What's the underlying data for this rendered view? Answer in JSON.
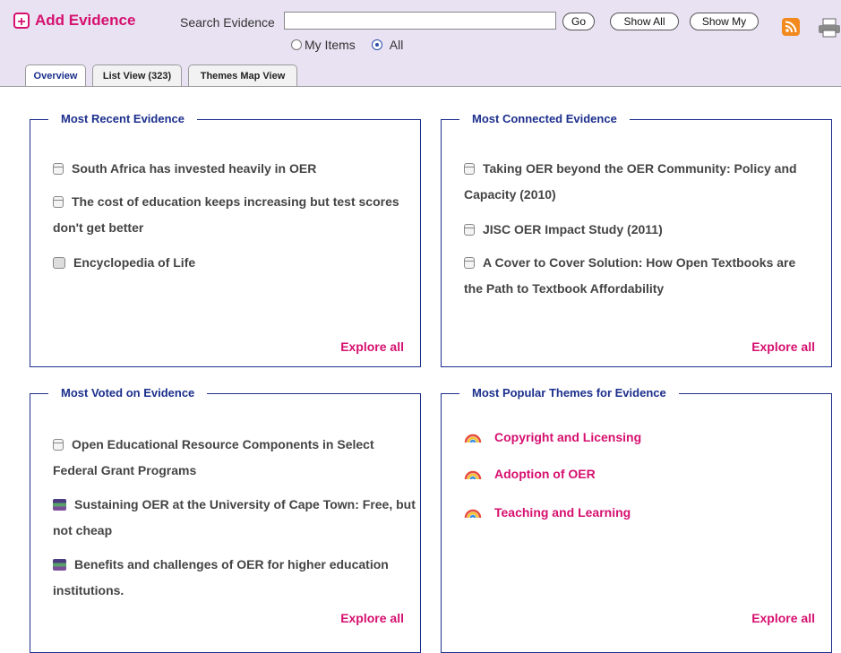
{
  "header": {
    "add_label": "Add Evidence",
    "search_label": "Search Evidence",
    "search_value": "",
    "go_label": "Go",
    "show_all_label": "Show All",
    "show_my_label": "Show My",
    "radio_my_items": "My Items",
    "radio_all": "All",
    "selected_radio": "All"
  },
  "tabs": [
    {
      "label": "Overview",
      "active": true
    },
    {
      "label": "List View (323)",
      "active": false
    },
    {
      "label": "Themes Map View",
      "active": false
    }
  ],
  "panels": {
    "recent": {
      "title": "Most Recent Evidence",
      "items": [
        {
          "icon": "document-icon",
          "text": "South Africa has invested heavily in OER"
        },
        {
          "icon": "document-icon",
          "text": "The cost of education keeps increasing but test scores don't get better"
        },
        {
          "icon": "website-icon",
          "text": "Encyclopedia of Life"
        }
      ],
      "explore": "Explore all"
    },
    "connected": {
      "title": "Most Connected Evidence",
      "items": [
        {
          "icon": "document-icon",
          "text": "Taking OER beyond the OER Community: Policy and Capacity (2010)"
        },
        {
          "icon": "document-icon",
          "text": "JISC OER Impact Study (2011)"
        },
        {
          "icon": "document-icon",
          "text": "A Cover to Cover Solution: How Open Textbooks are the Path to Textbook Affordability"
        }
      ],
      "explore": "Explore all"
    },
    "voted": {
      "title": "Most Voted on Evidence",
      "items": [
        {
          "icon": "document-icon",
          "text": "Open Educational Resource Components in Select Federal Grant Programs"
        },
        {
          "icon": "book-stack-icon",
          "text": "Sustaining OER at the University of Cape Town: Free, but not cheap"
        },
        {
          "icon": "book-stack-icon",
          "text": "Benefits and challenges of OER for higher education institutions."
        }
      ],
      "explore": "Explore all"
    },
    "themes": {
      "title": "Most Popular Themes for Evidence",
      "items": [
        {
          "icon": "theme-rainbow-icon",
          "text": "Copyright and Licensing"
        },
        {
          "icon": "theme-rainbow-icon",
          "text": "Adoption of OER"
        },
        {
          "icon": "theme-rainbow-icon",
          "text": "Teaching and Learning"
        }
      ],
      "explore": "Explore all"
    }
  },
  "colors": {
    "accent": "#d6106f",
    "heading": "#1c2f8c",
    "header_bg": "#e8e2f2",
    "rss": "#f28a1e"
  }
}
